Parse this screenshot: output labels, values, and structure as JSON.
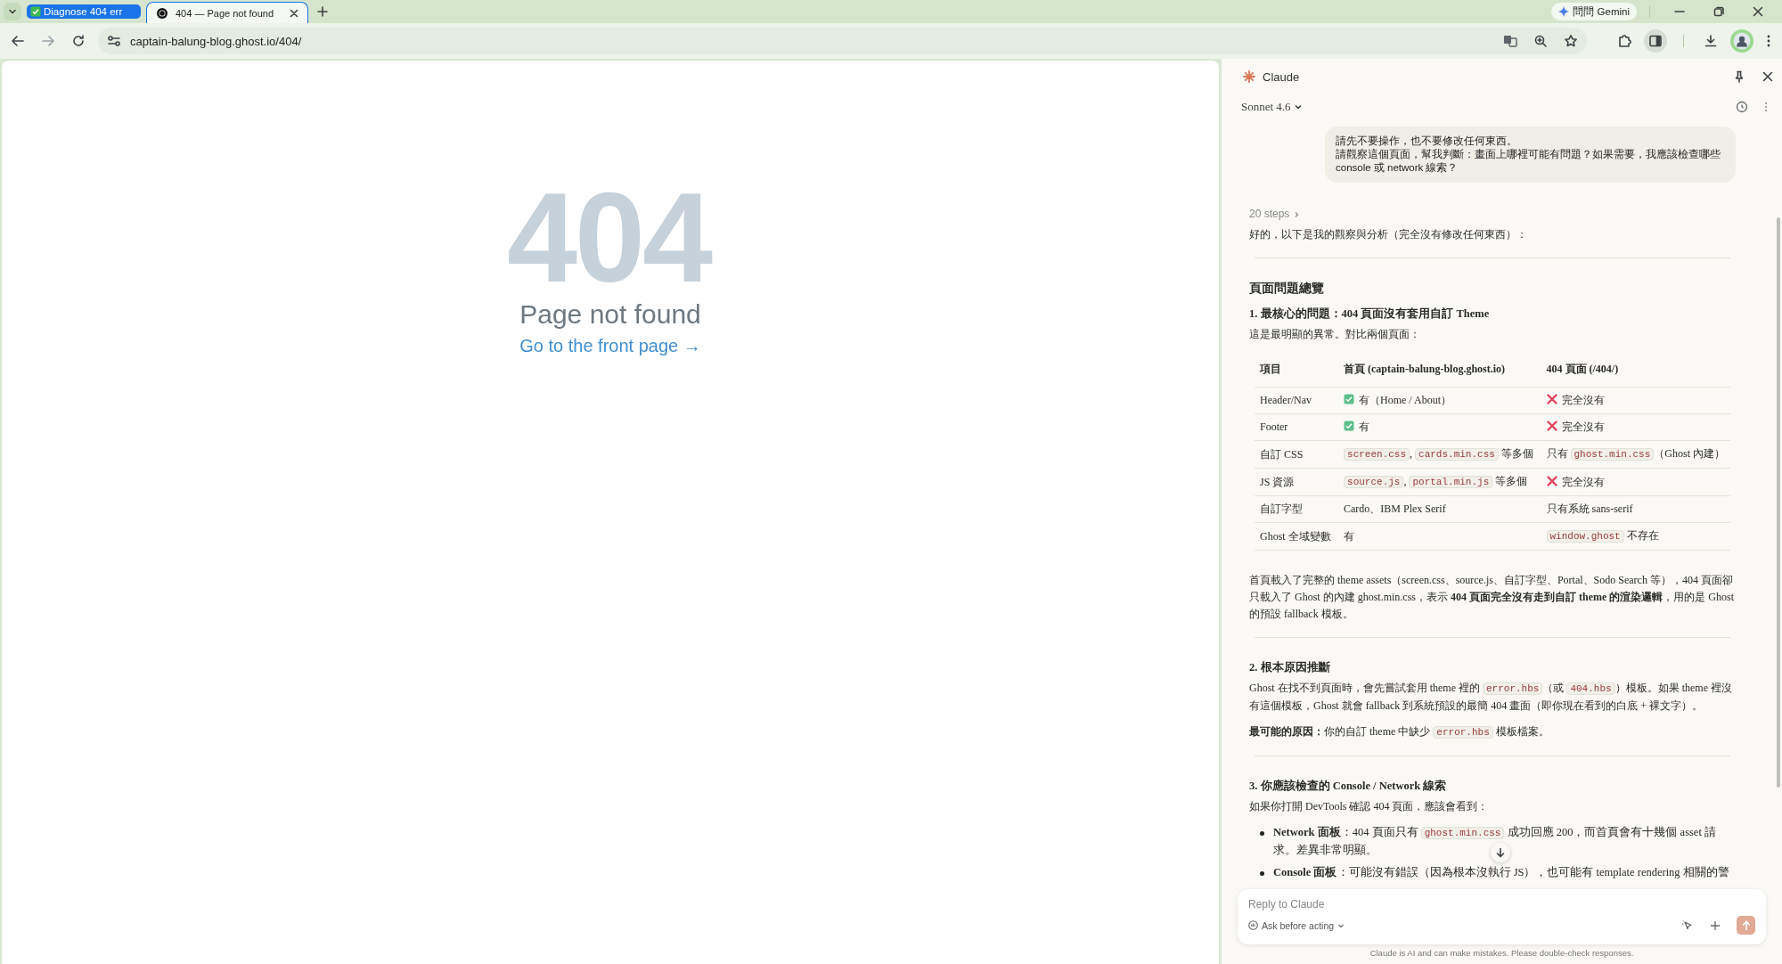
{
  "browser": {
    "tab_group": {
      "label": "Diagnose 404 err"
    },
    "tabs": [
      {
        "title": "404 — Page not found",
        "selected": true
      }
    ],
    "url": "captain-balung-blog.ghost.io/404/",
    "gemini_button": "問問 Gemini"
  },
  "page": {
    "code": "404",
    "message": "Page not found",
    "link": "Go to the front page →"
  },
  "side_panel": {
    "title": "Claude",
    "model": "Sonnet 4.6",
    "user_message": [
      "請先不要操作，也不要修改任何東西。",
      "請觀察這個頁面，幫我判斷：畫面上哪裡可能有問題？如果需要，我應該檢查哪些 console 或 network 線索？"
    ],
    "steps": "20 steps",
    "blocks": [
      {
        "kind": "paragraph",
        "parts": [
          {
            "kind": "text",
            "text": "好的，以下是我的觀察與分析（完全沒有修改任何東西）："
          }
        ]
      },
      {
        "kind": "divider"
      },
      {
        "kind": "heading",
        "text": "頁面問題總覽"
      },
      {
        "kind": "subheading",
        "text": "1. 最核心的問題：404 頁面沒有套用自訂 Theme"
      },
      {
        "kind": "paragraph",
        "parts": [
          {
            "kind": "text",
            "text": "這是最明顯的異常。對比兩個頁面："
          }
        ]
      },
      {
        "kind": "table",
        "columns": [
          "項目",
          "首頁 (captain-balung-blog.ghost.io)",
          "404 頁面 (/404/)"
        ],
        "rows": [
          [
            {
              "parts": [
                {
                  "kind": "text",
                  "text": "Header/Nav"
                }
              ]
            },
            {
              "kind": "check",
              "parts": [
                {
                  "kind": "text",
                  "text": "有（Home / About）"
                }
              ]
            },
            {
              "kind": "cross",
              "parts": [
                {
                  "kind": "text",
                  "text": "完全沒有"
                }
              ]
            }
          ],
          [
            {
              "parts": [
                {
                  "kind": "text",
                  "text": "Footer"
                }
              ]
            },
            {
              "kind": "check",
              "parts": [
                {
                  "kind": "text",
                  "text": "有"
                }
              ]
            },
            {
              "kind": "cross",
              "parts": [
                {
                  "kind": "text",
                  "text": "完全沒有"
                }
              ]
            }
          ],
          [
            {
              "parts": [
                {
                  "kind": "text",
                  "text": "自訂 CSS"
                }
              ]
            },
            {
              "parts": [
                {
                  "kind": "code",
                  "text": "screen.css"
                },
                {
                  "kind": "text",
                  "text": ", "
                },
                {
                  "kind": "code",
                  "text": "cards.min.css"
                },
                {
                  "kind": "text",
                  "text": " 等多個"
                }
              ]
            },
            {
              "parts": [
                {
                  "kind": "text",
                  "text": "只有 "
                },
                {
                  "kind": "code",
                  "text": "ghost.min.css"
                },
                {
                  "kind": "text",
                  "text": "（Ghost 內建）"
                }
              ]
            }
          ],
          [
            {
              "parts": [
                {
                  "kind": "text",
                  "text": "JS 資源"
                }
              ]
            },
            {
              "parts": [
                {
                  "kind": "code",
                  "text": "source.js"
                },
                {
                  "kind": "text",
                  "text": ", "
                },
                {
                  "kind": "code",
                  "text": "portal.min.js"
                },
                {
                  "kind": "text",
                  "text": " 等多個"
                }
              ]
            },
            {
              "kind": "cross",
              "parts": [
                {
                  "kind": "text",
                  "text": "完全沒有"
                }
              ]
            }
          ],
          [
            {
              "parts": [
                {
                  "kind": "text",
                  "text": "自訂字型"
                }
              ]
            },
            {
              "parts": [
                {
                  "kind": "text",
                  "text": "Cardo、IBM Plex Serif"
                }
              ]
            },
            {
              "parts": [
                {
                  "kind": "text",
                  "text": "只有系統 sans-serif"
                }
              ]
            }
          ],
          [
            {
              "parts": [
                {
                  "kind": "text",
                  "text": "Ghost 全域變數"
                }
              ]
            },
            {
              "parts": [
                {
                  "kind": "text",
                  "text": "有"
                }
              ]
            },
            {
              "parts": [
                {
                  "kind": "code",
                  "text": "window.ghost"
                },
                {
                  "kind": "text",
                  "text": " 不存在"
                }
              ]
            }
          ]
        ]
      },
      {
        "kind": "paragraph",
        "parts": [
          {
            "kind": "text",
            "text": "首頁載入了完整的 theme assets（screen.css、source.js、自訂字型、Portal、Sodo Search 等），404 頁面卻只載入了 Ghost 的內建 ghost.min.css，表示 "
          },
          {
            "kind": "bold",
            "text": "404 頁面完全沒有走到自訂 theme 的渲染邏輯"
          },
          {
            "kind": "text",
            "text": "，用的是 Ghost 的預設 fallback 模板。"
          }
        ]
      },
      {
        "kind": "divider"
      },
      {
        "kind": "subheading",
        "text": "2. 根本原因推斷"
      },
      {
        "kind": "paragraph",
        "parts": [
          {
            "kind": "text",
            "text": "Ghost 在找不到頁面時，會先嘗試套用 theme 裡的 "
          },
          {
            "kind": "code",
            "text": "error.hbs"
          },
          {
            "kind": "text",
            "text": "（或 "
          },
          {
            "kind": "code",
            "text": "404.hbs"
          },
          {
            "kind": "text",
            "text": "）模板。如果 theme 裡沒有這個模板，Ghost 就會 fallback 到系統預設的最簡 404 畫面（即你現在看到的白底 + 裸文字）。"
          }
        ]
      },
      {
        "kind": "paragraph",
        "parts": [
          {
            "kind": "bold",
            "text": "最可能的原因："
          },
          {
            "kind": "text",
            "text": "你的自訂 theme 中缺少 "
          },
          {
            "kind": "code",
            "text": "error.hbs"
          },
          {
            "kind": "text",
            "text": " 模板檔案。"
          }
        ]
      },
      {
        "kind": "divider"
      },
      {
        "kind": "subheading",
        "text": "3. 你應該檢查的 Console / Network 線索"
      },
      {
        "kind": "paragraph",
        "parts": [
          {
            "kind": "text",
            "text": "如果你打開 DevTools 確認 404 頁面，應該會看到："
          }
        ]
      },
      {
        "kind": "list",
        "items": [
          [
            {
              "kind": "bold",
              "text": "Network 面板"
            },
            {
              "kind": "text",
              "text": "：404 頁面只有 "
            },
            {
              "kind": "code",
              "text": "ghost.min.css"
            },
            {
              "kind": "text",
              "text": " 成功回應 200，而首頁會有十幾個 asset 請求。差異非常明顯。"
            }
          ],
          [
            {
              "kind": "bold",
              "text": "Console 面板"
            },
            {
              "kind": "text",
              "text": "：可能沒有錯誤（因為根本沒執行 JS），也可能有 template rendering 相關的警"
            }
          ]
        ]
      }
    ],
    "composer": {
      "placeholder": "Reply to Claude",
      "mode": "Ask before acting"
    },
    "disclaimer": "Claude is AI and can make mistakes. Please double-check responses."
  }
}
